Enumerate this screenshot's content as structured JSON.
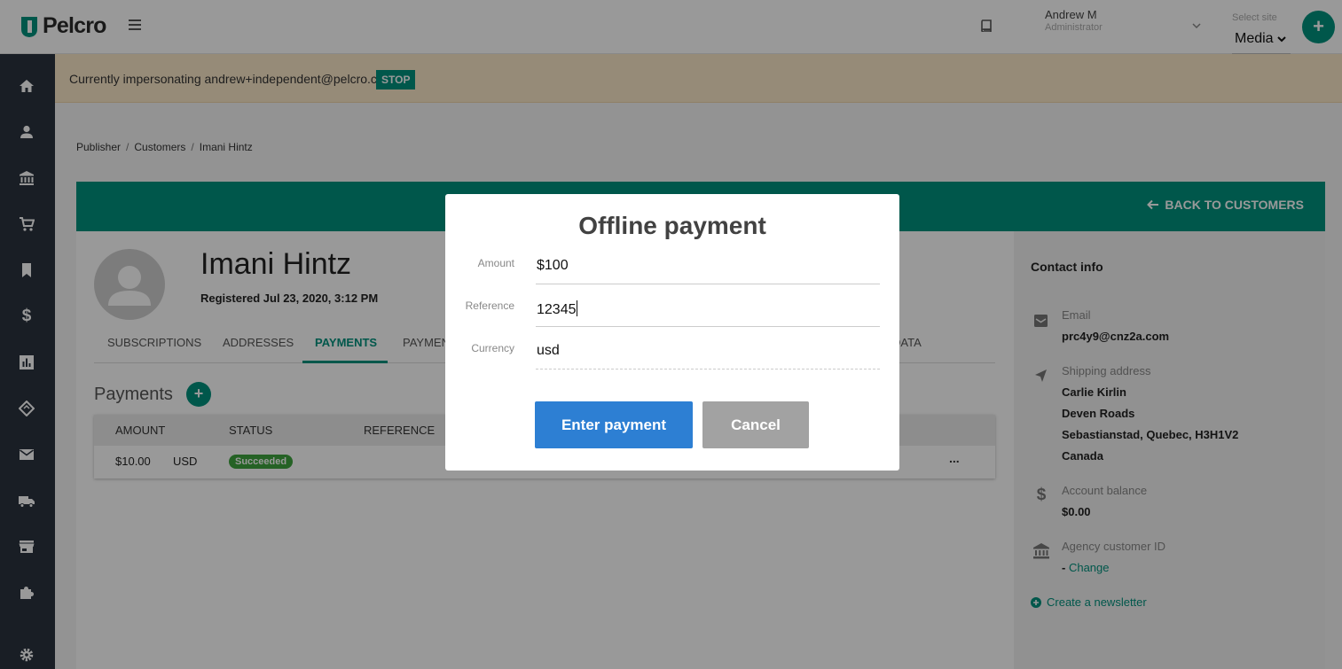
{
  "header": {
    "logo_text": "Pelcro",
    "user_name": "Andrew M",
    "user_role": "Administrator",
    "site_label": "Select site",
    "site_value": "Media",
    "add_label": "+"
  },
  "banner": {
    "text": "Currently impersonating andrew+independent@pelcro.com",
    "stop_label": "STOP"
  },
  "breadcrumb": [
    "Publisher",
    "Customers",
    "Imani Hintz"
  ],
  "card": {
    "back_label": "BACK TO CUSTOMERS"
  },
  "customer": {
    "name": "Imani Hintz",
    "registered": "Registered Jul 23, 2020, 3:12 PM"
  },
  "tabs": [
    "SUBSCRIPTIONS",
    "ADDRESSES",
    "PAYMENTS",
    "PAYMEN",
    "DATA"
  ],
  "payments": {
    "heading": "Payments",
    "add_label": "+",
    "columns": [
      "AMOUNT",
      "STATUS",
      "REFERENCE"
    ],
    "rows": [
      {
        "amount": "$10.00",
        "currency": "USD",
        "status": "Succeeded",
        "menu": "..."
      }
    ]
  },
  "contact": {
    "title": "Contact info",
    "email_label": "Email",
    "email": "prc4y9@cnz2a.com",
    "shipping_label": "Shipping address",
    "shipping_lines": [
      "Carlie Kirlin",
      "Deven Roads",
      "Sebastianstad, Quebec, H3H1V2",
      "Canada"
    ],
    "balance_label": "Account balance",
    "balance": "$0.00",
    "agency_label": "Agency customer ID",
    "agency_prefix": "- ",
    "agency_link": "Change",
    "newsletter": "Create a newsletter"
  },
  "modal": {
    "title": "Offline payment",
    "amount_label": "Amount",
    "amount_value": "$100",
    "reference_label": "Reference",
    "reference_value": "12345",
    "currency_label": "Currency",
    "currency_value": "usd",
    "enter_label": "Enter payment",
    "cancel_label": "Cancel"
  },
  "colors": {
    "brand": "#00917d",
    "sidebar": "#2b333f",
    "primary_button": "#2d7fd3",
    "success": "#3ea33e",
    "banner_bg": "#fbe8c9"
  }
}
